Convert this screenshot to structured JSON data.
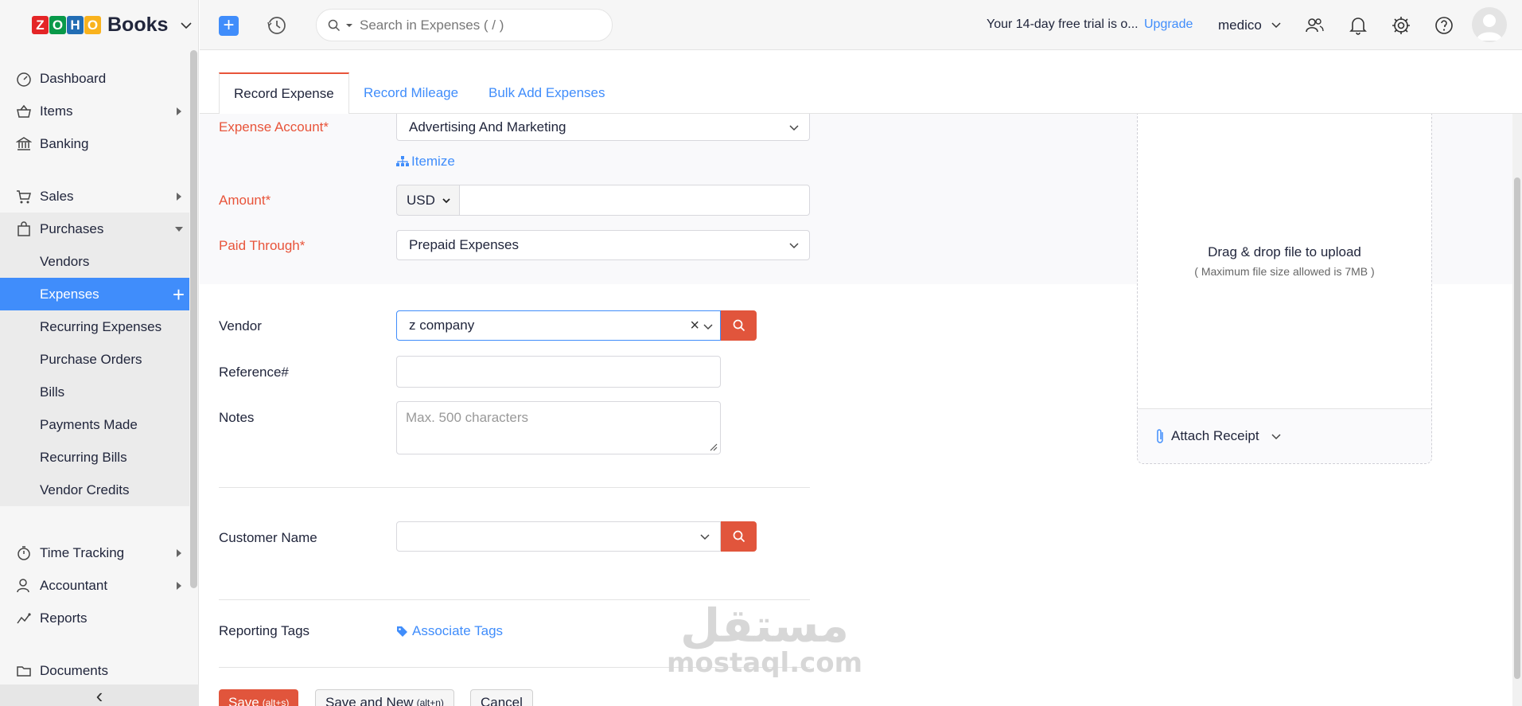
{
  "brand": {
    "letters": [
      {
        "ch": "Z",
        "color": "#e42527"
      },
      {
        "ch": "O",
        "color": "#089949"
      },
      {
        "ch": "H",
        "color": "#226db4"
      },
      {
        "ch": "O",
        "color": "#f9b21d"
      }
    ],
    "name": "Books"
  },
  "sidebar": {
    "items": [
      {
        "label": "Dashboard"
      },
      {
        "label": "Items"
      },
      {
        "label": "Banking"
      },
      {
        "label": "Sales"
      },
      {
        "label": "Purchases"
      },
      {
        "label": "Time Tracking"
      },
      {
        "label": "Accountant"
      },
      {
        "label": "Reports"
      },
      {
        "label": "Documents"
      }
    ],
    "purchases_sub": [
      {
        "label": "Vendors"
      },
      {
        "label": "Expenses"
      },
      {
        "label": "Recurring Expenses"
      },
      {
        "label": "Purchase Orders"
      },
      {
        "label": "Bills"
      },
      {
        "label": "Payments Made"
      },
      {
        "label": "Recurring Bills"
      },
      {
        "label": "Vendor Credits"
      }
    ],
    "collapse_glyph": "‹"
  },
  "header": {
    "search_placeholder": "Search in Expenses ( / )",
    "trial_text": "Your 14-day free trial is o...",
    "upgrade_label": "Upgrade",
    "org_name": "medico"
  },
  "tabs": [
    {
      "label": "Record Expense"
    },
    {
      "label": "Record Mileage"
    },
    {
      "label": "Bulk Add Expenses"
    }
  ],
  "form": {
    "expense_account_label": "Expense Account*",
    "expense_account_value": "Advertising And Marketing",
    "itemize_label": "Itemize",
    "amount_label": "Amount*",
    "currency": "USD",
    "amount_value": "",
    "paid_through_label": "Paid Through*",
    "paid_through_value": "Prepaid Expenses",
    "vendor_label": "Vendor",
    "vendor_value": "z company",
    "reference_label": "Reference#",
    "reference_value": "",
    "notes_label": "Notes",
    "notes_placeholder": "Max. 500 characters",
    "customer_label": "Customer Name",
    "customer_value": "",
    "tags_label": "Reporting Tags",
    "associate_tags_label": "Associate Tags"
  },
  "upload": {
    "title": "Drag & drop file to upload",
    "subtitle": "( Maximum file size allowed is 7MB )",
    "attach_label": "Attach Receipt"
  },
  "buttons": {
    "save": "Save",
    "save_shortcut": "(alt+s)",
    "save_new": "Save and New",
    "save_new_shortcut": "(alt+n)",
    "cancel": "Cancel"
  },
  "watermark": {
    "arabic": "مستقل",
    "latin": "mostaql.com"
  },
  "colors": {
    "accent_blue": "#408dfb",
    "required_red": "#e8543a",
    "save_red": "#e1553c",
    "help_orange": "#f5a623"
  }
}
